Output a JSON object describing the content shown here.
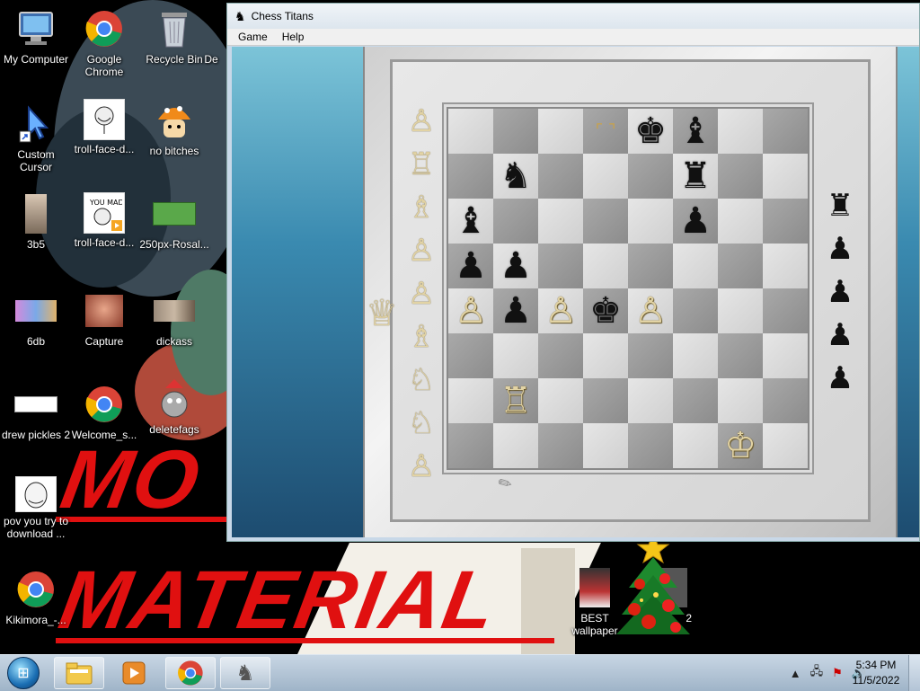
{
  "desktop": {
    "icons": [
      {
        "label": "My Computer",
        "icon": "computer-icon"
      },
      {
        "label": "Google Chrome",
        "icon": "chrome-icon"
      },
      {
        "label": "Recycle Bin",
        "icon": "recycle-bin-icon"
      },
      {
        "label": "De",
        "icon": "file-icon"
      },
      {
        "label": "Custom Cursor",
        "icon": "cursor-shortcut-icon"
      },
      {
        "label": "troll-face-d...",
        "icon": "image-thumbnail-icon"
      },
      {
        "label": "no bitches",
        "icon": "image-thumbnail-icon"
      },
      {
        "label": "3b5",
        "icon": "image-thumbnail-icon"
      },
      {
        "label": "troll-face-d...",
        "icon": "video-thumbnail-icon"
      },
      {
        "label": "250px-Rosal...",
        "icon": "image-thumbnail-icon"
      },
      {
        "label": "6db",
        "icon": "image-thumbnail-icon"
      },
      {
        "label": "Capture",
        "icon": "image-thumbnail-icon"
      },
      {
        "label": "dickass",
        "icon": "image-thumbnail-icon"
      },
      {
        "label": "drew pickles 2",
        "icon": "image-thumbnail-icon"
      },
      {
        "label": "Welcome_s...",
        "icon": "chrome-icon"
      },
      {
        "label": "deletefags",
        "icon": "image-thumbnail-icon"
      },
      {
        "label": "pov you try to download ...",
        "icon": "image-thumbnail-icon"
      },
      {
        "label": "Kikimora_-...",
        "icon": "chrome-icon"
      },
      {
        "label": "BEST wallpaper",
        "icon": "image-thumbnail-icon"
      },
      {
        "label": "2",
        "icon": "image-thumbnail-icon"
      }
    ],
    "banner_top": "MO",
    "banner_bottom": "MATERIAL"
  },
  "window": {
    "title": "Chess Titans",
    "menu": [
      "Game",
      "Help"
    ]
  },
  "chess": {
    "board_ranks": [
      "...*kb..",
      ".n...r..",
      "b....p..",
      "pp......",
      "PpPkP...",
      "........",
      ".R......",
      "......K."
    ],
    "captured_white": [
      "♙",
      "♖",
      "♗",
      "♙",
      "♙",
      "♗",
      "♘",
      "♘",
      "♙"
    ],
    "captured_white_queen": "♕",
    "captured_black": [
      "♜",
      "♟",
      "♟",
      "♟",
      "♟"
    ],
    "right_edge_white": [
      "♙"
    ],
    "right_edge_black_knight": "♞"
  },
  "taskbar": {
    "pinned": [
      "explorer-icon",
      "media-player-icon",
      "chrome-icon",
      "chess-titans-icon"
    ],
    "time": "5:34 PM",
    "date": "11/5/2022"
  }
}
